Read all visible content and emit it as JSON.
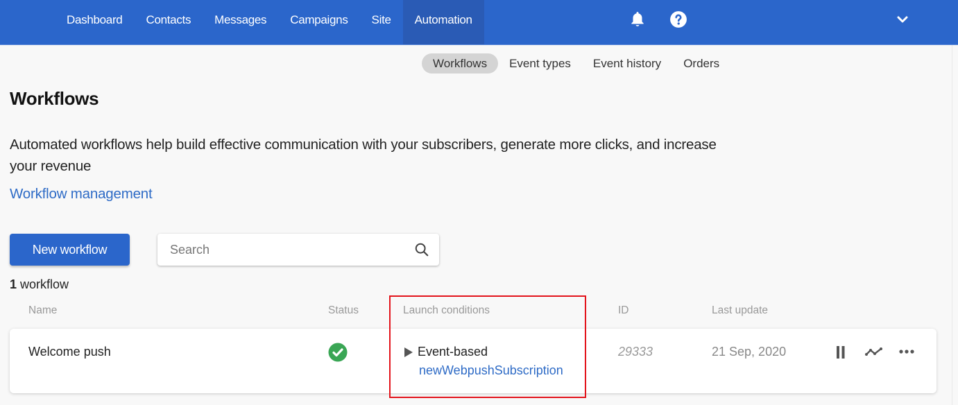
{
  "topbar": {
    "nav": [
      {
        "label": "Dashboard",
        "active": false
      },
      {
        "label": "Contacts",
        "active": false
      },
      {
        "label": "Messages",
        "active": false
      },
      {
        "label": "Campaigns",
        "active": false
      },
      {
        "label": "Site",
        "active": false
      },
      {
        "label": "Automation",
        "active": true
      }
    ],
    "icons": [
      "bell-icon",
      "help-icon",
      "chevron-down-icon"
    ],
    "brand_color": "#2b66cb"
  },
  "subnav": [
    {
      "label": "Workflows",
      "active": true
    },
    {
      "label": "Event types",
      "active": false
    },
    {
      "label": "Event history",
      "active": false
    },
    {
      "label": "Orders",
      "active": false
    }
  ],
  "page": {
    "title": "Workflows",
    "description": "Automated workflows help build effective communication with your subscribers, generate more clicks, and increase your revenue",
    "management_link": "Workflow management",
    "new_button": "New workflow",
    "search_placeholder": "Search",
    "search_value": "",
    "count_number": "1",
    "count_label": "workflow"
  },
  "table": {
    "headers": {
      "name": "Name",
      "status": "Status",
      "launch": "Launch conditions",
      "id": "ID",
      "updated": "Last update"
    },
    "rows": [
      {
        "name": "Welcome push",
        "status": "active",
        "status_color": "#3aa655",
        "trigger_type": "Event-based",
        "trigger_event": "newWebpushSubscription",
        "id": "29333",
        "last_update": "21 Sep, 2020",
        "actions": [
          "pause-icon",
          "statistics-icon",
          "more-icon"
        ]
      }
    ]
  },
  "annotation": {
    "highlight_color": "#e3131b",
    "target": "Launch conditions"
  }
}
